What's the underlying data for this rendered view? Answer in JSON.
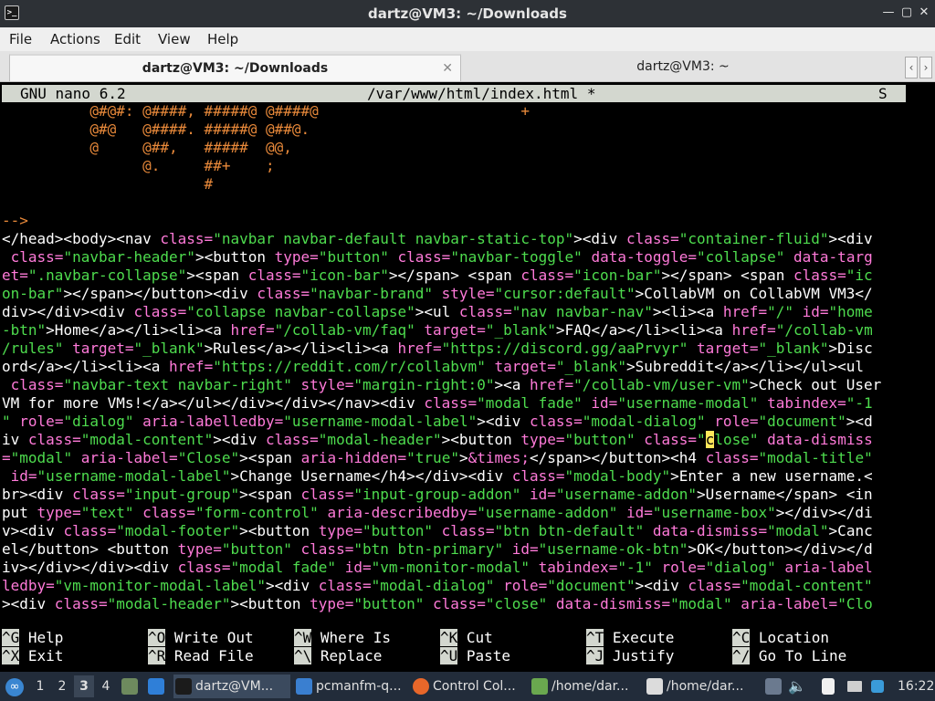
{
  "window": {
    "title": "dartz@VM3: ~/Downloads",
    "app_icon": "terminal-icon"
  },
  "menu": [
    "File",
    "Actions",
    "Edit",
    "View",
    "Help"
  ],
  "tabs": [
    {
      "label": "dartz@VM3: ~/Downloads",
      "active": true
    },
    {
      "label": "dartz@VM3: ~",
      "active": false
    }
  ],
  "nano": {
    "version": "GNU nano 6.2",
    "file": "/var/www/html/index.html *",
    "flag": "S"
  },
  "ascii_art": [
    "          @#@#: @####, #####@ @####@                       +",
    "          @#@   @####. #####@ @##@.",
    "          @     @##,   #####  @@,",
    "                @.     ##+    ;",
    "                       #"
  ],
  "comment_end": "-->",
  "code_lines": [
    [
      [
        "tx",
        "</head><body><nav "
      ],
      [
        "attr",
        "class="
      ],
      [
        "str",
        "\"navbar navbar-default navbar-static-top\""
      ],
      [
        "tx",
        "><div "
      ],
      [
        "attr",
        "class="
      ],
      [
        "str",
        "\"container-fluid\""
      ],
      [
        "tx",
        "><div"
      ]
    ],
    [
      [
        "tx",
        " "
      ],
      [
        "attr",
        "class="
      ],
      [
        "str",
        "\"navbar-header\""
      ],
      [
        "tx",
        "><button "
      ],
      [
        "attr",
        "type="
      ],
      [
        "str",
        "\"button\""
      ],
      [
        "tx",
        " "
      ],
      [
        "attr",
        "class="
      ],
      [
        "str",
        "\"navbar-toggle\""
      ],
      [
        "tx",
        " "
      ],
      [
        "attr",
        "data-toggle="
      ],
      [
        "str",
        "\"collapse\""
      ],
      [
        "tx",
        " "
      ],
      [
        "attr",
        "data-targ"
      ]
    ],
    [
      [
        "attr",
        "et="
      ],
      [
        "str",
        "\".navbar-collapse\""
      ],
      [
        "tx",
        "><span "
      ],
      [
        "attr",
        "class="
      ],
      [
        "str",
        "\"icon-bar\""
      ],
      [
        "tx",
        "></span> <span "
      ],
      [
        "attr",
        "class="
      ],
      [
        "str",
        "\"icon-bar\""
      ],
      [
        "tx",
        "></span> <span "
      ],
      [
        "attr",
        "class="
      ],
      [
        "str",
        "\"ic"
      ]
    ],
    [
      [
        "str",
        "on-bar\""
      ],
      [
        "tx",
        "></span></button><div "
      ],
      [
        "attr",
        "class="
      ],
      [
        "str",
        "\"navbar-brand\""
      ],
      [
        "tx",
        " "
      ],
      [
        "attr",
        "style="
      ],
      [
        "str",
        "\"cursor:default\""
      ],
      [
        "tx",
        ">CollabVM on CollabVM VM3</"
      ]
    ],
    [
      [
        "tx",
        "div></div><div "
      ],
      [
        "attr",
        "class="
      ],
      [
        "str",
        "\"collapse navbar-collapse\""
      ],
      [
        "tx",
        "><ul "
      ],
      [
        "attr",
        "class="
      ],
      [
        "str",
        "\"nav navbar-nav\""
      ],
      [
        "tx",
        "><li><a "
      ],
      [
        "attr",
        "href="
      ],
      [
        "str",
        "\"/\""
      ],
      [
        "tx",
        " "
      ],
      [
        "attr",
        "id="
      ],
      [
        "str",
        "\"home"
      ]
    ],
    [
      [
        "str",
        "-btn\""
      ],
      [
        "tx",
        ">Home</a></li><li><a "
      ],
      [
        "attr",
        "href="
      ],
      [
        "str",
        "\"/collab-vm/faq\""
      ],
      [
        "tx",
        " "
      ],
      [
        "attr",
        "target="
      ],
      [
        "str",
        "\"_blank\""
      ],
      [
        "tx",
        ">FAQ</a></li><li><a "
      ],
      [
        "attr",
        "href="
      ],
      [
        "str",
        "\"/collab-vm"
      ]
    ],
    [
      [
        "str",
        "/rules\""
      ],
      [
        "tx",
        " "
      ],
      [
        "attr",
        "target="
      ],
      [
        "str",
        "\"_blank\""
      ],
      [
        "tx",
        ">Rules</a></li><li><a "
      ],
      [
        "attr",
        "href="
      ],
      [
        "str",
        "\"https://discord.gg/aaPrvyr\""
      ],
      [
        "tx",
        " "
      ],
      [
        "attr",
        "target="
      ],
      [
        "str",
        "\"_blank\""
      ],
      [
        "tx",
        ">Disc"
      ]
    ],
    [
      [
        "tx",
        "ord</a></li><li><a "
      ],
      [
        "attr",
        "href="
      ],
      [
        "str",
        "\"https://reddit.com/r/collabvm\""
      ],
      [
        "tx",
        " "
      ],
      [
        "attr",
        "target="
      ],
      [
        "str",
        "\"_blank\""
      ],
      [
        "tx",
        ">Subreddit</a></li></ul><ul"
      ]
    ],
    [
      [
        "tx",
        " "
      ],
      [
        "attr",
        "class="
      ],
      [
        "str",
        "\"navbar-text navbar-right\""
      ],
      [
        "tx",
        " "
      ],
      [
        "attr",
        "style="
      ],
      [
        "str",
        "\"margin-right:0\""
      ],
      [
        "tx",
        "><a "
      ],
      [
        "attr",
        "href="
      ],
      [
        "str",
        "\"/collab-vm/user-vm\""
      ],
      [
        "tx",
        ">Check out User"
      ]
    ],
    [
      [
        "tx",
        "VM for more VMs!</a></ul></div></div></nav><div "
      ],
      [
        "attr",
        "class="
      ],
      [
        "str",
        "\"modal fade\""
      ],
      [
        "tx",
        " "
      ],
      [
        "attr",
        "id="
      ],
      [
        "str",
        "\"username-modal\""
      ],
      [
        "tx",
        " "
      ],
      [
        "attr",
        "tabindex="
      ],
      [
        "str",
        "\"-1"
      ]
    ],
    [
      [
        "str",
        "\""
      ],
      [
        "tx",
        " "
      ],
      [
        "attr",
        "role="
      ],
      [
        "str",
        "\"dialog\""
      ],
      [
        "tx",
        " "
      ],
      [
        "attr",
        "aria-labelledby="
      ],
      [
        "str",
        "\"username-modal-label\""
      ],
      [
        "tx",
        "><div "
      ],
      [
        "attr",
        "class="
      ],
      [
        "str",
        "\"modal-dialog\""
      ],
      [
        "tx",
        " "
      ],
      [
        "attr",
        "role="
      ],
      [
        "str",
        "\"document\""
      ],
      [
        "tx",
        "><d"
      ]
    ],
    [
      [
        "tx",
        "iv "
      ],
      [
        "attr",
        "class="
      ],
      [
        "str",
        "\"modal-content\""
      ],
      [
        "tx",
        "><div "
      ],
      [
        "attr",
        "class="
      ],
      [
        "str",
        "\"modal-header\""
      ],
      [
        "tx",
        "><button "
      ],
      [
        "attr",
        "type="
      ],
      [
        "str",
        "\"button\""
      ],
      [
        "tx",
        " "
      ],
      [
        "attr",
        "class="
      ],
      [
        "str",
        "\""
      ],
      [
        "cursor",
        "c"
      ],
      [
        "str",
        "lose\""
      ],
      [
        "tx",
        " "
      ],
      [
        "attr",
        "data-dismiss"
      ]
    ],
    [
      [
        "attr",
        "="
      ],
      [
        "str",
        "\"modal\""
      ],
      [
        "tx",
        " "
      ],
      [
        "attr",
        "aria-label="
      ],
      [
        "str",
        "\"Close\""
      ],
      [
        "tx",
        "><span "
      ],
      [
        "attr",
        "aria-hidden="
      ],
      [
        "str",
        "\"true\""
      ],
      [
        "tx",
        ">"
      ],
      [
        "attr",
        "&times;"
      ],
      [
        "tx",
        "</span></button><h4 "
      ],
      [
        "attr",
        "class="
      ],
      [
        "str",
        "\"modal-title\""
      ]
    ],
    [
      [
        "tx",
        " "
      ],
      [
        "attr",
        "id="
      ],
      [
        "str",
        "\"username-modal-label\""
      ],
      [
        "tx",
        ">Change Username</h4></div><div "
      ],
      [
        "attr",
        "class="
      ],
      [
        "str",
        "\"modal-body\""
      ],
      [
        "tx",
        ">Enter a new username.<"
      ]
    ],
    [
      [
        "tx",
        "br><div "
      ],
      [
        "attr",
        "class="
      ],
      [
        "str",
        "\"input-group\""
      ],
      [
        "tx",
        "><span "
      ],
      [
        "attr",
        "class="
      ],
      [
        "str",
        "\"input-group-addon\""
      ],
      [
        "tx",
        " "
      ],
      [
        "attr",
        "id="
      ],
      [
        "str",
        "\"username-addon\""
      ],
      [
        "tx",
        ">Username</span> <in"
      ]
    ],
    [
      [
        "tx",
        "put "
      ],
      [
        "attr",
        "type="
      ],
      [
        "str",
        "\"text\""
      ],
      [
        "tx",
        " "
      ],
      [
        "attr",
        "class="
      ],
      [
        "str",
        "\"form-control\""
      ],
      [
        "tx",
        " "
      ],
      [
        "attr",
        "aria-describedby="
      ],
      [
        "str",
        "\"username-addon\""
      ],
      [
        "tx",
        " "
      ],
      [
        "attr",
        "id="
      ],
      [
        "str",
        "\"username-box\""
      ],
      [
        "tx",
        "></div></di"
      ]
    ],
    [
      [
        "tx",
        "v><div "
      ],
      [
        "attr",
        "class="
      ],
      [
        "str",
        "\"modal-footer\""
      ],
      [
        "tx",
        "><button "
      ],
      [
        "attr",
        "type="
      ],
      [
        "str",
        "\"button\""
      ],
      [
        "tx",
        " "
      ],
      [
        "attr",
        "class="
      ],
      [
        "str",
        "\"btn btn-default\""
      ],
      [
        "tx",
        " "
      ],
      [
        "attr",
        "data-dismiss="
      ],
      [
        "str",
        "\"modal\""
      ],
      [
        "tx",
        ">Canc"
      ]
    ],
    [
      [
        "tx",
        "el</button> <button "
      ],
      [
        "attr",
        "type="
      ],
      [
        "str",
        "\"button\""
      ],
      [
        "tx",
        " "
      ],
      [
        "attr",
        "class="
      ],
      [
        "str",
        "\"btn btn-primary\""
      ],
      [
        "tx",
        " "
      ],
      [
        "attr",
        "id="
      ],
      [
        "str",
        "\"username-ok-btn\""
      ],
      [
        "tx",
        ">OK</button></div></d"
      ]
    ],
    [
      [
        "tx",
        "iv></div></div><div "
      ],
      [
        "attr",
        "class="
      ],
      [
        "str",
        "\"modal fade\""
      ],
      [
        "tx",
        " "
      ],
      [
        "attr",
        "id="
      ],
      [
        "str",
        "\"vm-monitor-modal\""
      ],
      [
        "tx",
        " "
      ],
      [
        "attr",
        "tabindex="
      ],
      [
        "str",
        "\"-1\""
      ],
      [
        "tx",
        " "
      ],
      [
        "attr",
        "role="
      ],
      [
        "str",
        "\"dialog\""
      ],
      [
        "tx",
        " "
      ],
      [
        "attr",
        "aria-label"
      ]
    ],
    [
      [
        "attr",
        "ledby="
      ],
      [
        "str",
        "\"vm-monitor-modal-label\""
      ],
      [
        "tx",
        "><div "
      ],
      [
        "attr",
        "class="
      ],
      [
        "str",
        "\"modal-dialog\""
      ],
      [
        "tx",
        " "
      ],
      [
        "attr",
        "role="
      ],
      [
        "str",
        "\"document\""
      ],
      [
        "tx",
        "><div "
      ],
      [
        "attr",
        "class="
      ],
      [
        "str",
        "\"modal-content\""
      ]
    ],
    [
      [
        "tx",
        "><div "
      ],
      [
        "attr",
        "class="
      ],
      [
        "str",
        "\"modal-header\""
      ],
      [
        "tx",
        "><button "
      ],
      [
        "attr",
        "type="
      ],
      [
        "str",
        "\"button\""
      ],
      [
        "tx",
        " "
      ],
      [
        "attr",
        "class="
      ],
      [
        "str",
        "\"close\""
      ],
      [
        "tx",
        " "
      ],
      [
        "attr",
        "data-dismiss="
      ],
      [
        "str",
        "\"modal\""
      ],
      [
        "tx",
        " "
      ],
      [
        "attr",
        "aria-label="
      ],
      [
        "str",
        "\"Clo"
      ]
    ]
  ],
  "shortcuts": {
    "row1": [
      {
        "key": "^G",
        "label": "Help"
      },
      {
        "key": "^O",
        "label": "Write Out"
      },
      {
        "key": "^W",
        "label": "Where Is"
      },
      {
        "key": "^K",
        "label": "Cut"
      },
      {
        "key": "^T",
        "label": "Execute"
      },
      {
        "key": "^C",
        "label": "Location"
      }
    ],
    "row2": [
      {
        "key": "^X",
        "label": "Exit"
      },
      {
        "key": "^R",
        "label": "Read File"
      },
      {
        "key": "^\\",
        "label": "Replace"
      },
      {
        "key": "^U",
        "label": "Paste"
      },
      {
        "key": "^J",
        "label": "Justify"
      },
      {
        "key": "^/",
        "label": "Go To Line"
      }
    ]
  },
  "taskbar": {
    "workspaces": [
      "1",
      "2",
      "3",
      "4"
    ],
    "active_workspace": "3",
    "tasks": [
      {
        "label": "dartz@VM...",
        "icon": "terminal-icon",
        "active": true
      },
      {
        "label": "pcmanfm-q...",
        "icon": "folder-icon",
        "active": false
      },
      {
        "label": "Control Col...",
        "icon": "firefox-icon",
        "active": false
      },
      {
        "label": "/home/dar...",
        "icon": "text-editor-icon",
        "active": false
      },
      {
        "label": "/home/dar...",
        "icon": "image-viewer-icon",
        "active": false
      }
    ],
    "clock": "16:22"
  },
  "colors": {
    "titlebar_bg": "#2d3136",
    "taskbar_bg": "#222c3a",
    "nano_header_bg": "#d3d7cf",
    "syntax_tag": "#ffffff",
    "syntax_attr": "#ff7ad9",
    "syntax_string": "#4edc4e",
    "ascii_art": "#e8893a"
  }
}
